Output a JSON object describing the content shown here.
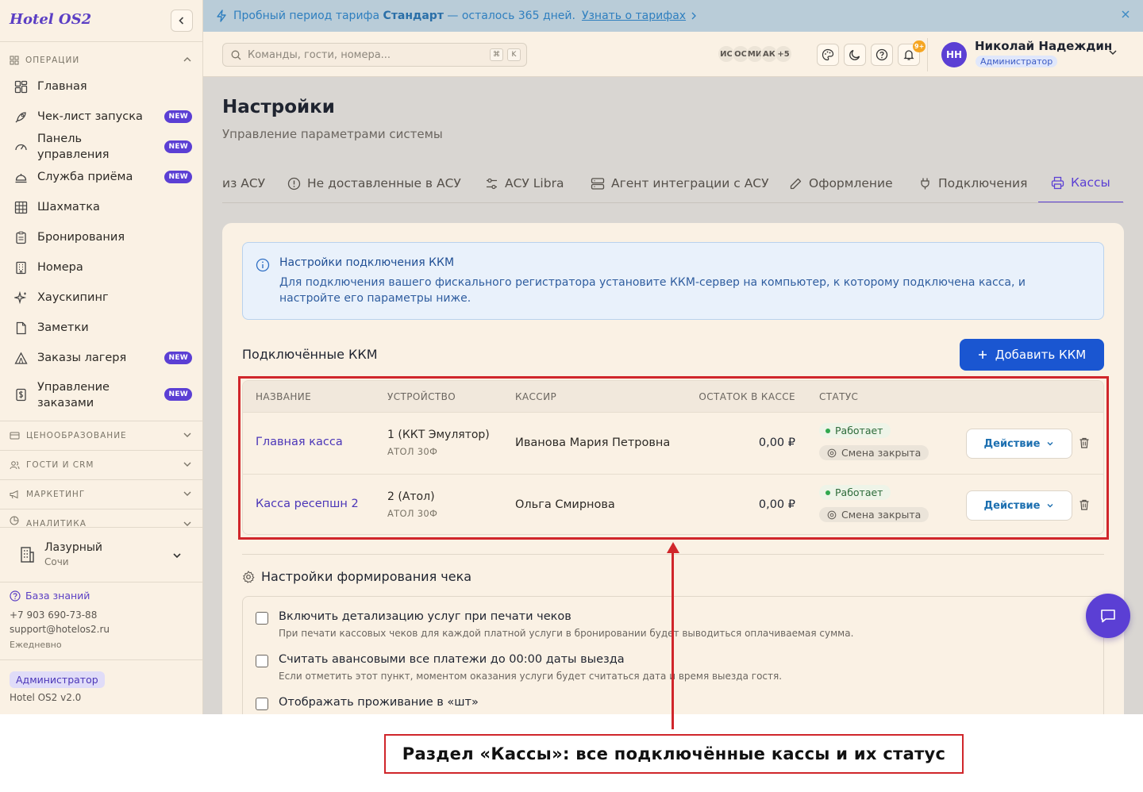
{
  "sidebar": {
    "logo": "Hotel OS2",
    "section_operations": "Операции",
    "items": [
      {
        "label": "Главная",
        "badge": ""
      },
      {
        "label": "Чек-лист запуска",
        "badge": "NEW"
      },
      {
        "label": "Панель управления",
        "badge": "NEW"
      },
      {
        "label": "Служба приёма",
        "badge": "NEW"
      },
      {
        "label": "Шахматка",
        "badge": ""
      },
      {
        "label": "Бронирования",
        "badge": ""
      },
      {
        "label": "Номера",
        "badge": ""
      },
      {
        "label": "Хаускипинг",
        "badge": ""
      },
      {
        "label": "Заметки",
        "badge": ""
      },
      {
        "label": "Заказы лагеря",
        "badge": "NEW"
      },
      {
        "label": "Управление заказами",
        "badge": "NEW"
      }
    ],
    "sections": [
      "Ценообразование",
      "Гости и CRM",
      "Маркетинг",
      "Аналитика"
    ],
    "hotel": {
      "name": "Лазурный",
      "city": "Сочи"
    },
    "knowledge_base": "База знаний",
    "phone": "+7 903 690-73-88",
    "email": "support@hotelos2.ru",
    "schedule": "Ежедневно",
    "role": "Администратор",
    "version": "Hotel OS2 v2.0"
  },
  "banner": {
    "text_before": "Пробный период тарифа",
    "plan": "Стандарт",
    "text_after": "— осталось 365 дней.",
    "link": "Узнать о тарифах"
  },
  "header": {
    "search_placeholder": "Команды, гости, номера...",
    "kbd1": "⌘",
    "kbd2": "K",
    "avatars": [
      "ИС",
      "ОС",
      "МИ",
      "АК",
      "+5"
    ],
    "notifications": "9+",
    "user_initials": "НН",
    "user_name": "Николай Надеждин",
    "user_role": "Администратор"
  },
  "page": {
    "title": "Настройки",
    "subtitle": "Управление параметрами системы",
    "tabs": [
      "из АСУ",
      "Не доставленные в АСУ",
      "АСУ Libra",
      "Агент интеграции с АСУ",
      "Оформление",
      "Подключения",
      "Кассы"
    ],
    "active_tab": "Кассы"
  },
  "info": {
    "title": "Настройки подключения ККМ",
    "text": "Для подключения вашего фискального регистратора установите ККМ-сервер на компьютер, к которому подключена касса, и настройте его параметры ниже."
  },
  "kkm": {
    "section_title": "Подключённые ККМ",
    "add_button": "Добавить ККМ",
    "columns": [
      "Название",
      "Устройство",
      "Кассир",
      "Остаток в кассе",
      "Статус"
    ],
    "rows": [
      {
        "name": "Главная касса",
        "device": "1 (ККТ Эмулятор)",
        "device_model": "АТОЛ 30Ф",
        "cashier": "Иванова Мария Петровна",
        "balance": "0,00 ₽",
        "status": "Работает",
        "shift": "Смена закрыта",
        "action": "Действие"
      },
      {
        "name": "Касса ресепшн 2",
        "device": "2 (Атол)",
        "device_model": "АТОЛ 30Ф",
        "cashier": "Ольга Смирнова",
        "balance": "0,00 ₽",
        "status": "Работает",
        "shift": "Смена закрыта",
        "action": "Действие"
      }
    ]
  },
  "receipt": {
    "title": "Настройки формирования чека",
    "options": [
      {
        "label": "Включить детализацию услуг при печати чеков",
        "desc": "При печати кассовых чеков для каждой платной услуги в бронировании будет выводиться оплачиваемая сумма."
      },
      {
        "label": "Считать авансовыми все платежи до 00:00 даты выезда",
        "desc": "Если отметить этот пункт, моментом оказания услуги будет считаться дата и время выезда гостя."
      },
      {
        "label": "Отображать проживание в «шт»",
        "desc": ""
      }
    ]
  },
  "annotation": {
    "caption": "Раздел «Кассы»: все подключённые кассы и их статус"
  },
  "colors": {
    "accent": "#5b3fd4",
    "primary_button": "#1a56d1",
    "highlight": "#d0262b"
  }
}
